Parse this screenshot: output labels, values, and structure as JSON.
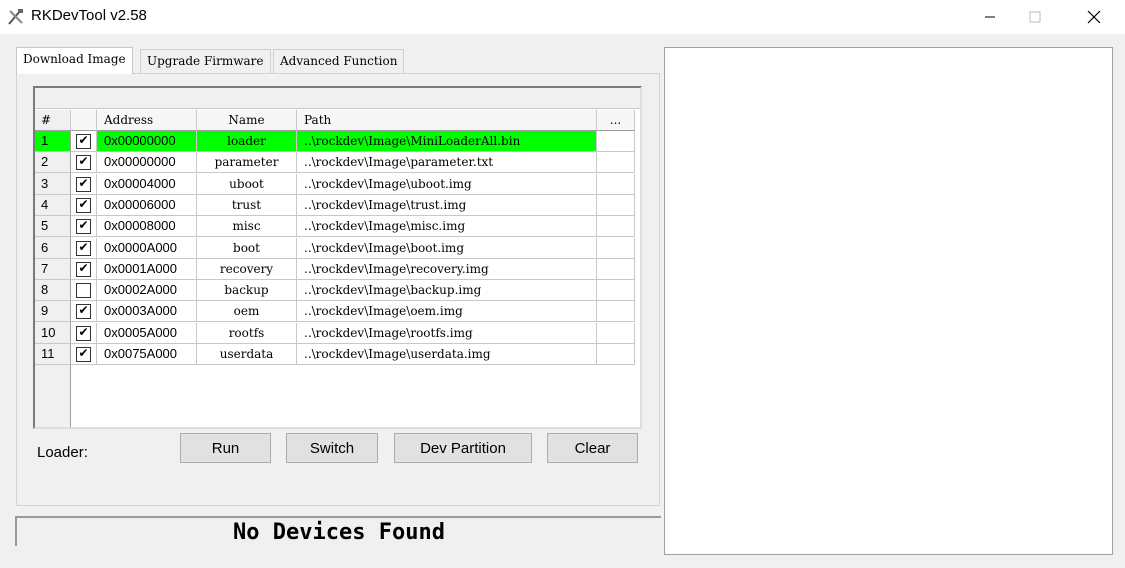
{
  "window": {
    "title": "RKDevTool v2.58"
  },
  "tabs": [
    {
      "label": "Download Image",
      "active": true
    },
    {
      "label": "Upgrade Firmware",
      "active": false
    },
    {
      "label": "Advanced Function",
      "active": false
    }
  ],
  "grid": {
    "columns": [
      "#",
      "",
      "Address",
      "Name",
      "Path",
      "..."
    ],
    "selected_row": 1,
    "rows": [
      {
        "num": "1",
        "checked": true,
        "address": "0x00000000",
        "name": "loader",
        "path": "..\\rockdev\\Image\\MiniLoaderAll.bin"
      },
      {
        "num": "2",
        "checked": true,
        "address": "0x00000000",
        "name": "parameter",
        "path": "..\\rockdev\\Image\\parameter.txt"
      },
      {
        "num": "3",
        "checked": true,
        "address": "0x00004000",
        "name": "uboot",
        "path": "..\\rockdev\\Image\\uboot.img"
      },
      {
        "num": "4",
        "checked": true,
        "address": "0x00006000",
        "name": "trust",
        "path": "..\\rockdev\\Image\\trust.img"
      },
      {
        "num": "5",
        "checked": true,
        "address": "0x00008000",
        "name": "misc",
        "path": "..\\rockdev\\Image\\misc.img"
      },
      {
        "num": "6",
        "checked": true,
        "address": "0x0000A000",
        "name": "boot",
        "path": "..\\rockdev\\Image\\boot.img"
      },
      {
        "num": "7",
        "checked": true,
        "address": "0x0001A000",
        "name": "recovery",
        "path": "..\\rockdev\\Image\\recovery.img"
      },
      {
        "num": "8",
        "checked": false,
        "address": "0x0002A000",
        "name": "backup",
        "path": "..\\rockdev\\Image\\backup.img"
      },
      {
        "num": "9",
        "checked": true,
        "address": "0x0003A000",
        "name": "oem",
        "path": "..\\rockdev\\Image\\oem.img"
      },
      {
        "num": "10",
        "checked": true,
        "address": "0x0005A000",
        "name": "rootfs",
        "path": "..\\rockdev\\Image\\rootfs.img"
      },
      {
        "num": "11",
        "checked": true,
        "address": "0x0075A000",
        "name": "userdata",
        "path": "..\\rockdev\\Image\\userdata.img"
      }
    ]
  },
  "controls": {
    "loader_label": "Loader:",
    "run": "Run",
    "switch": "Switch",
    "dev_partition": "Dev Partition",
    "clear": "Clear"
  },
  "status": {
    "text": "No Devices Found"
  },
  "colors": {
    "selected_row": "#00ff00"
  }
}
